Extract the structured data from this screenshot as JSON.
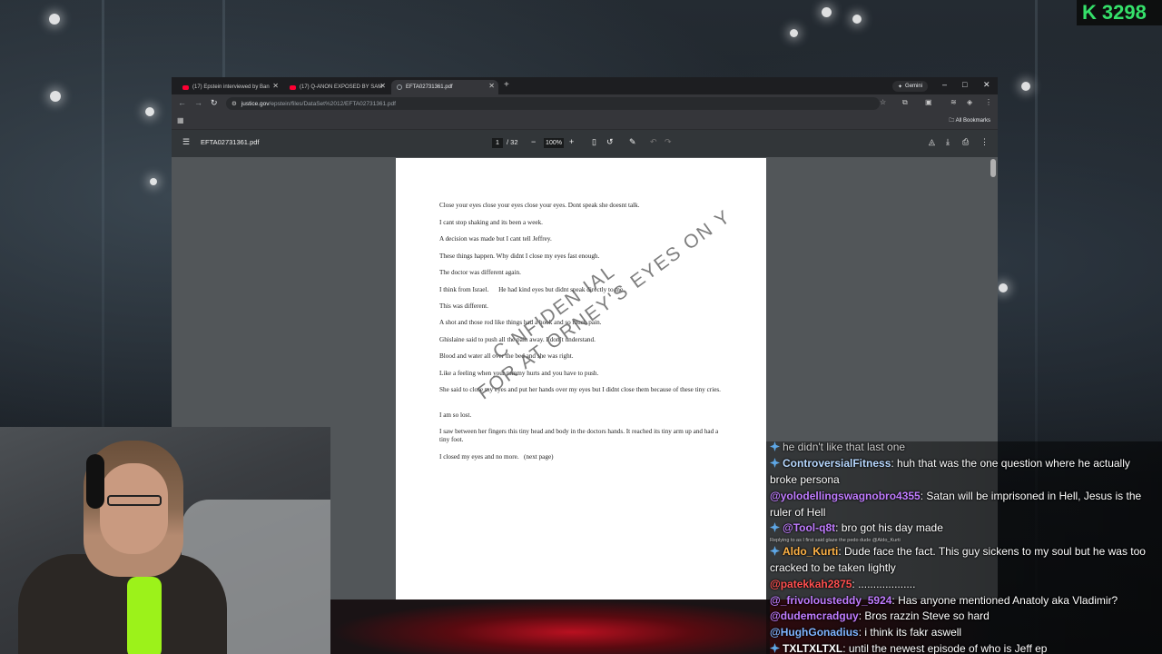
{
  "counter": {
    "icon": "K",
    "value": "3298"
  },
  "browser": {
    "tabs": [
      {
        "title": "(17) Epstein interviewed by Ban",
        "icon": "youtube-icon"
      },
      {
        "title": "(17) Q-ANON EXPOSED BY SAM",
        "icon": "youtube-icon"
      },
      {
        "title": "EFTA02731361.pdf",
        "icon": "globe-icon",
        "active": true
      }
    ],
    "new_tab": "+",
    "gemini_label": "Gemini",
    "url_host": "justice.gov",
    "url_path": "/epstein/files/DataSet%2012/EFTA02731361.pdf",
    "all_bookmarks": "All Bookmarks"
  },
  "pdf": {
    "filename": "EFTA02731361.pdf",
    "current_page": "1",
    "total_pages": "/ 32",
    "zoom": "100%",
    "lines": [
      "Close your eyes close your eyes close your eyes. Dont speak she doesnt talk.",
      "I cant stop shaking and its been a week.",
      "A decision was made but I cant tell Jeffrey.",
      "These things happen. Why didnt I close my eyes fast enough.",
      "The doctor was different again.",
      "I think from Israel.      He had kind eyes but didnt speak directly to me.",
      "This was different.",
      "A shot and those rod like things had a hook and so much pain.",
      "Ghislaine said to push all the pain away. I don’t understand.",
      "Blood and water all over the bed and she was right.",
      "Like a feeling when your tummy hurts and you have to push.",
      "She said to close my eyes and put her hands over my eyes but I didnt close them because of these tiny cries.",
      "I am so lost.",
      "I saw between her fingers this tiny head and body in the doctors hands. It reached its tiny arm up and had a tiny foot.",
      "I closed my eyes and no more.   (next page)"
    ],
    "watermark_line1": "C  NFIDEN  IAL",
    "watermark_line2": "FOR AT  ORNEY'S EYES ON  Y"
  },
  "chat": {
    "partial_top": "he didn't like that last one",
    "messages": [
      {
        "user": "ControversialFitness",
        "color": "#b7d8ff",
        "badge": true,
        "text": ": huh that was the one question where he actually broke persona"
      },
      {
        "user": "@yolodellingswagnobro4355",
        "color": "#c07cff",
        "badge": false,
        "text": ": Satan will be imprisoned in Hell, Jesus is the ruler of Hell"
      },
      {
        "user": "@Tool-q8t",
        "color": "#c07cff",
        "badge": true,
        "text": ": bro got his day made"
      },
      {
        "user": "Aldo_Kurti",
        "color": "#ffb347",
        "badge": true,
        "text": ": Dude face the fact. This guy sickens to my soul but he was too cracked to be taken lightly"
      },
      {
        "user": "@patekkah2875",
        "color": "#ff4f4f",
        "badge": false,
        "text": ": ..................."
      },
      {
        "user": "@_frivolousteddy_5924",
        "color": "#c07cff",
        "badge": false,
        "text": ": Has anyone mentioned Anatoly aka Vladimir?"
      },
      {
        "user": "@dudemcradguy",
        "color": "#c07cff",
        "badge": false,
        "text": ": Bros razzin Steve so hard"
      },
      {
        "user": "@HughGonadius",
        "color": "#7fb4ff",
        "badge": false,
        "text": ": i think its fakr aswell"
      },
      {
        "user": "TXLTXLTXL",
        "color": "#ffffff",
        "badge": true,
        "text": ": until the newest episode of who is Jeff ep"
      }
    ],
    "reply_note": "Replying to   as I first said glaze the pedo dude @Aldo_Kurti"
  }
}
